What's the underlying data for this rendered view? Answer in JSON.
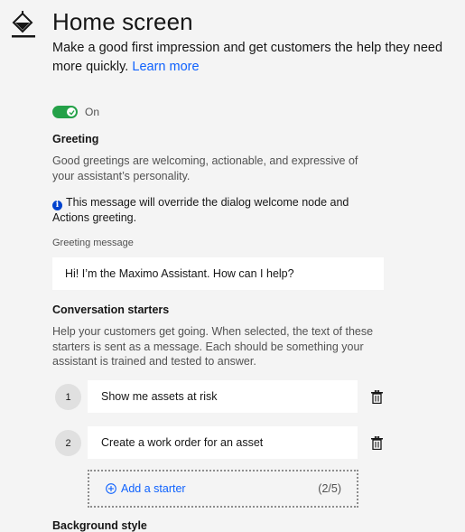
{
  "header": {
    "icon": "paint-bucket-icon",
    "title": "Home screen",
    "description": "Make a good first impression and get customers the help they need more quickly.",
    "learn_more": "Learn more"
  },
  "toggle": {
    "state": "On",
    "color": "#24a148"
  },
  "greeting": {
    "heading": "Greeting",
    "help": "Good greetings are welcoming, actionable, and expressive of your assistant’s personality.",
    "note": "This message will override the dialog welcome node and Actions greeting.",
    "field_label": "Greeting message",
    "value": "Hi! I’m the Maximo Assistant. How can I help?"
  },
  "starters": {
    "heading": "Conversation starters",
    "help": "Help your customers get going. When selected, the text of these starters is sent as a message. Each should be something your assistant is trained and tested to answer.",
    "items": [
      {
        "num": "1",
        "text": "Show me assets at risk"
      },
      {
        "num": "2",
        "text": "Create a work order for an asset"
      }
    ],
    "add_label": "Add a starter",
    "count": "(2/5)"
  },
  "background": {
    "heading": "Background style"
  },
  "colors": {
    "link": "#0f62fe",
    "info": "#0043ce"
  }
}
